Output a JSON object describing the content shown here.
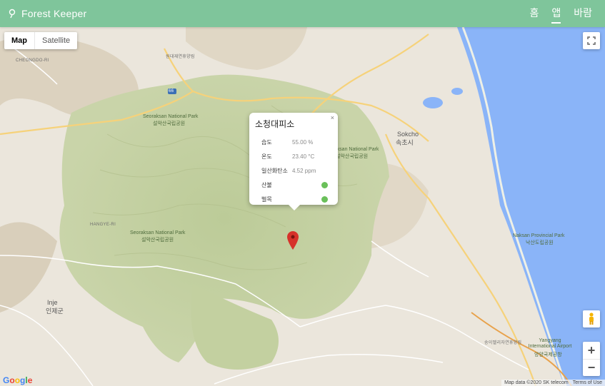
{
  "header": {
    "brand": "Forest Keeper",
    "nav": [
      "홈",
      "앱",
      "바람"
    ]
  },
  "map": {
    "type_buttons": [
      "Map",
      "Satellite"
    ],
    "google_letters": [
      "G",
      "o",
      "o",
      "g",
      "l",
      "e"
    ],
    "attribution": [
      "Map data ©2020 SK telecom",
      "Terms of Use"
    ],
    "places": {
      "wonjeong": "원대재연휴양림",
      "cheongdo": "CHEONGDO-RI",
      "seorak_park_1": "Seoraksan National Park",
      "seorak_park_1_ko": "설악산국립공원",
      "sokcho_en": "Sokcho",
      "sokcho_ko": "속초시",
      "seorak_park_2": "Seoraksan National Park",
      "seorak_park_2_ko": "설악산국립공원",
      "seorak_park_3": "Seoraksan National Park",
      "seorak_park_3_ko": "설악산국립공원",
      "inje_en": "Inje",
      "inje_ko": "인제군",
      "naksan": "Naksan Provincial Park",
      "naksan_ko": "낙산도립공원",
      "yangyang": "Yangyang International Airport",
      "yangyang_ko": "양양국제공항",
      "songcheon": "송이벨리자연휴양림",
      "hangye": "HANGYE-RI",
      "route66": "66"
    }
  },
  "info_window": {
    "title": "소청대피소",
    "close": "×",
    "rows": [
      {
        "label": "습도",
        "value": "55.00 %"
      },
      {
        "label": "온도",
        "value": "23.40 °C"
      },
      {
        "label": "일산화탄소",
        "value": "4.52 ppm"
      }
    ],
    "status_rows": [
      {
        "label": "산불",
        "status": "normal"
      },
      {
        "label": "벌목",
        "status": "normal"
      }
    ]
  },
  "colors": {
    "header": "#7fc59b",
    "status_ok": "#6ac05a",
    "marker": "#d6322a",
    "sea": "#8ab4f8"
  }
}
